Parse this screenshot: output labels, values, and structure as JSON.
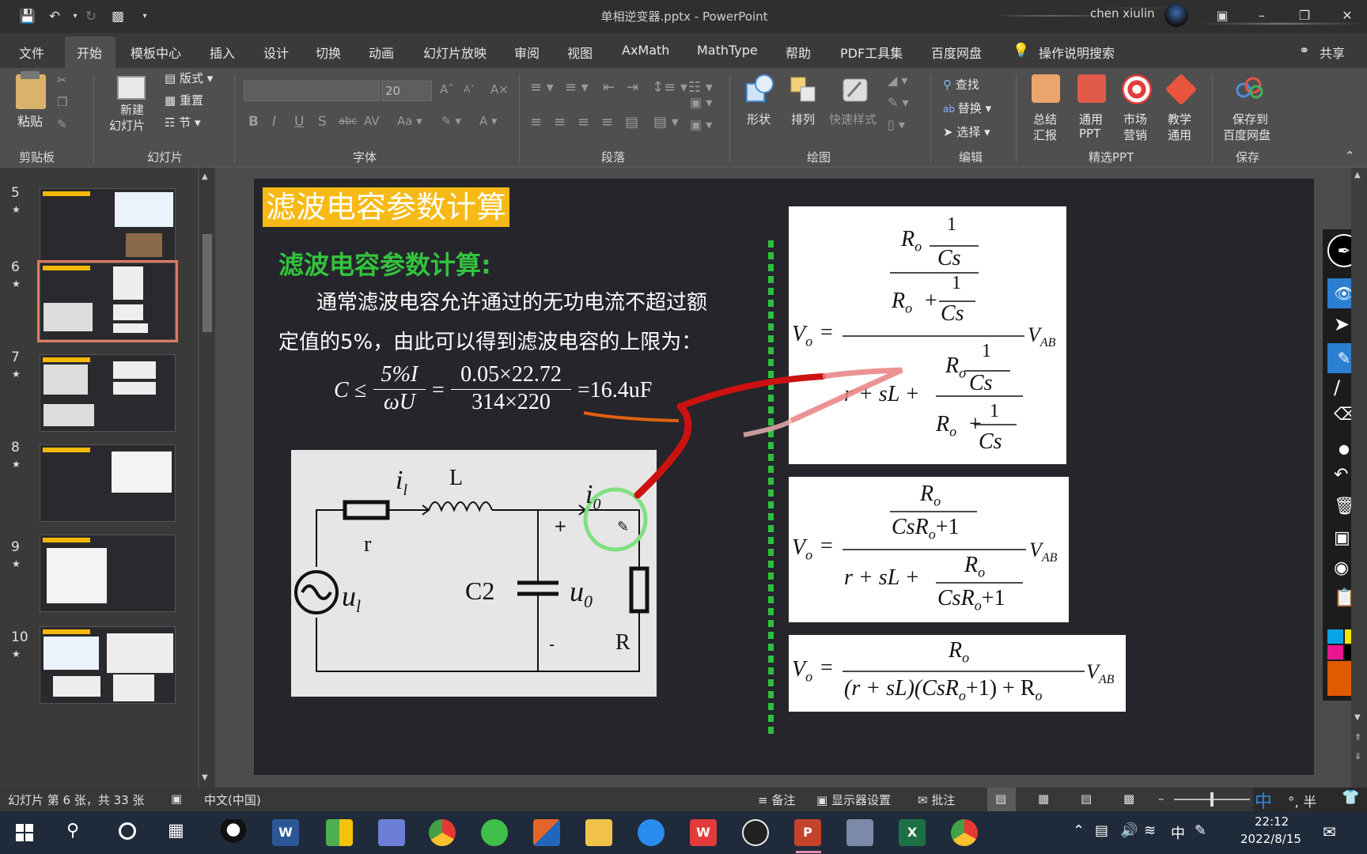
{
  "window": {
    "title": "单相逆变器.pptx  -  PowerPoint",
    "user": "chen xiulin"
  },
  "menu": [
    "文件",
    "开始",
    "模板中心",
    "插入",
    "设计",
    "切换",
    "动画",
    "幻灯片放映",
    "审阅",
    "视图",
    "AxMath",
    "MathType",
    "帮助",
    "PDF工具集",
    "百度网盘",
    "操作说明搜索",
    "共享"
  ],
  "ribbon": {
    "clipboard": {
      "paste": "粘贴",
      "group": "剪贴板"
    },
    "slides": {
      "new_slide_1": "新建",
      "new_slide_2": "幻灯片",
      "layout": "版式",
      "reset": "重置",
      "section": "节",
      "group": "幻灯片"
    },
    "font": {
      "font_name": "",
      "font_size": "20",
      "group": "字体"
    },
    "paragraph": {
      "group": "段落"
    },
    "drawing": {
      "shapes": "形状",
      "arrange": "排列",
      "quick_styles": "快速样式",
      "group": "绘图"
    },
    "editing": {
      "find": "查找",
      "replace": "替换",
      "select": "选择",
      "group": "编辑"
    },
    "featured": {
      "summary_1": "总结",
      "summary_2": "汇报",
      "general_1": "通用",
      "general_2": "PPT",
      "market_1": "市场",
      "market_2": "营销",
      "teach_1": "教学",
      "teach_2": "通用",
      "group": "精选PPT"
    },
    "save": {
      "label_1": "保存到",
      "label_2": "百度网盘",
      "group": "保存"
    }
  },
  "thumbnails": [
    {
      "num": "5",
      "star": "★"
    },
    {
      "num": "6",
      "star": "★"
    },
    {
      "num": "7",
      "star": "★"
    },
    {
      "num": "8",
      "star": "★"
    },
    {
      "num": "9",
      "star": "★"
    },
    {
      "num": "10",
      "star": "★"
    }
  ],
  "slide": {
    "title": "滤波电容参数计算",
    "section_title": "滤波电容参数计算:",
    "para_line1": "通常滤波电容允许通过的无功电流不超过额",
    "para_line2": "定值的5%，由此可以得到滤波电容的上限为：",
    "eq": {
      "c": "C ≤",
      "f1_num": "5%I",
      "f1_den": "ωU",
      "eq1": "=",
      "f2_num": "0.05×22.72",
      "f2_den": "314×220",
      "result": "=16.4uF"
    },
    "circuit": {
      "i_l": "i",
      "i_l_sub": "l",
      "L": "L",
      "r": "r",
      "u_l": "u",
      "u_l_sub": "l",
      "C2": "C2",
      "u0": "u",
      "u0_sub": "0",
      "i0": "i",
      "i0_sub": "0",
      "R": "R",
      "plus": "+",
      "minus": "-"
    },
    "formula1": {
      "Vo": "V",
      "o": "o",
      "eq": "=",
      "Ro": "R",
      "one": "1",
      "Cs": "Cs",
      "plus": "+",
      "rsl": "r + sL +",
      "VAB": "V",
      "AB": "AB"
    },
    "formula2": {
      "Ro": "R",
      "den": "CsR",
      "den2": "+1",
      "rsl": "r + sL +"
    },
    "formula3": {
      "den": "(r + sL)(CsR",
      "den2": "+1) + R"
    }
  },
  "status": {
    "slide_info": "幻灯片 第 6 张，共 33 张",
    "lang": "中文(中国)",
    "notes": "备注",
    "display": "显示器设置",
    "comments": "批注",
    "ime": "中",
    "ime2": "°, 半"
  },
  "taskbar": {
    "time": "22:12",
    "date": "2022/8/15",
    "ime": "中"
  }
}
